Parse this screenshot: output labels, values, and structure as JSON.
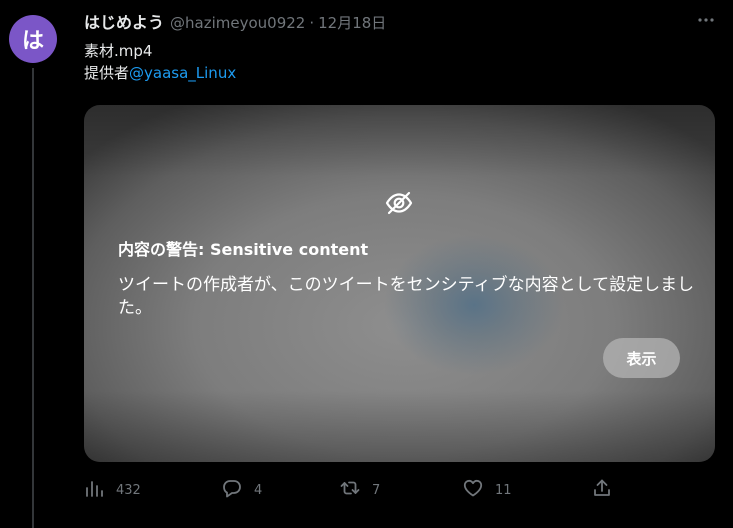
{
  "author": {
    "avatar_char": "は",
    "avatar_color": "#7b56c7",
    "display_name": "はじめよう",
    "handle": "@hazimeyou0922",
    "separator": "·",
    "date": "12月18日"
  },
  "tweet": {
    "line1": "素材.mp4",
    "line2_prefix": "提供者",
    "mention": "@yaasa_Linux",
    "mention_color": "#1d9bf0"
  },
  "media": {
    "warning_title": "内容の警告: Sensitive content",
    "warning_body": "ツイートの作成者が、このツイートをセンシティブな内容として設定しました。",
    "show_button_label": "表示",
    "icon": "eye-off-icon"
  },
  "actions": {
    "views": {
      "icon": "views-chart-icon",
      "count": "432"
    },
    "reply": {
      "icon": "reply-bubble-icon",
      "count": "4"
    },
    "retweet": {
      "icon": "retweet-icon",
      "count": "7"
    },
    "like": {
      "icon": "heart-icon",
      "count": "11"
    },
    "share": {
      "icon": "share-icon"
    }
  },
  "more_icon": "more-options-icon"
}
